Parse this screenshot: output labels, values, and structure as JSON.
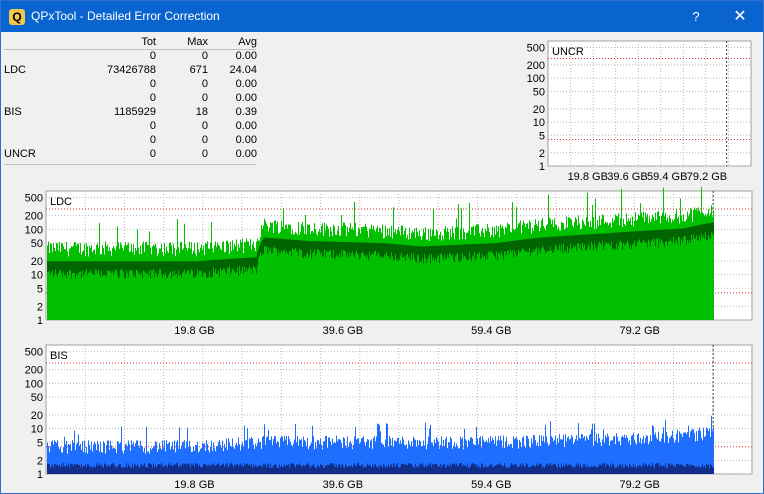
{
  "window": {
    "title": "QPxTool - Detailed Error Correction",
    "icon": "qpxtool-app-icon",
    "help_label": "?",
    "close_label": "✕",
    "titlebar_color": "#0a64cf"
  },
  "stats": {
    "headers": [
      "",
      "Tot",
      "Max",
      "Avg"
    ],
    "rows": [
      [
        "",
        "0",
        "0",
        "0.00"
      ],
      [
        "LDC",
        "73426788",
        "671",
        "24.04"
      ],
      [
        "",
        "0",
        "0",
        "0.00"
      ],
      [
        "",
        "0",
        "0",
        "0.00"
      ],
      [
        "BIS",
        "1185929",
        "18",
        "0.39"
      ],
      [
        "",
        "0",
        "0",
        "0.00"
      ],
      [
        "",
        "0",
        "0",
        "0.00"
      ],
      [
        "UNCR",
        "0",
        "0",
        "0.00"
      ]
    ]
  },
  "chart_data": [
    {
      "type": "area",
      "title": "UNCR",
      "x_ticks": [
        "19.8 GB",
        "39.6 GB",
        "59.4 GB",
        "79.2 GB"
      ],
      "y_ticks": [
        "500",
        "200",
        "100",
        "50",
        "20",
        "10",
        "5",
        "2",
        "1"
      ],
      "y_scale": "log",
      "series": []
    },
    {
      "type": "area",
      "title": "LDC",
      "x_ticks": [
        "19.8 GB",
        "39.6 GB",
        "59.4 GB",
        "79.2 GB"
      ],
      "y_ticks": [
        "500",
        "200",
        "100",
        "50",
        "20",
        "10",
        "5",
        "2",
        "1"
      ],
      "y_scale": "log",
      "colors": {
        "peak": "#00c000",
        "avg": "#006400"
      },
      "series": [
        {
          "x_gb": [
            0,
            10,
            20,
            28,
            29,
            35,
            45,
            50,
            60,
            66,
            75,
            85,
            89
          ],
          "values": [
            18,
            18,
            18,
            22,
            60,
            50,
            45,
            38,
            45,
            60,
            75,
            95,
            130
          ]
        }
      ]
    },
    {
      "type": "area",
      "title": "BIS",
      "x_ticks": [
        "19.8 GB",
        "39.6 GB",
        "59.4 GB",
        "79.2 GB"
      ],
      "y_ticks": [
        "500",
        "200",
        "100",
        "50",
        "20",
        "10",
        "5",
        "2",
        "1"
      ],
      "y_scale": "log",
      "colors": {
        "peak": "#1e6fff",
        "avg": "#102e8a"
      },
      "series": [
        {
          "x_gb": [
            0,
            20,
            29,
            40,
            60,
            80,
            89
          ],
          "values": [
            4,
            4,
            5,
            5,
            5,
            6,
            8
          ]
        }
      ]
    }
  ]
}
